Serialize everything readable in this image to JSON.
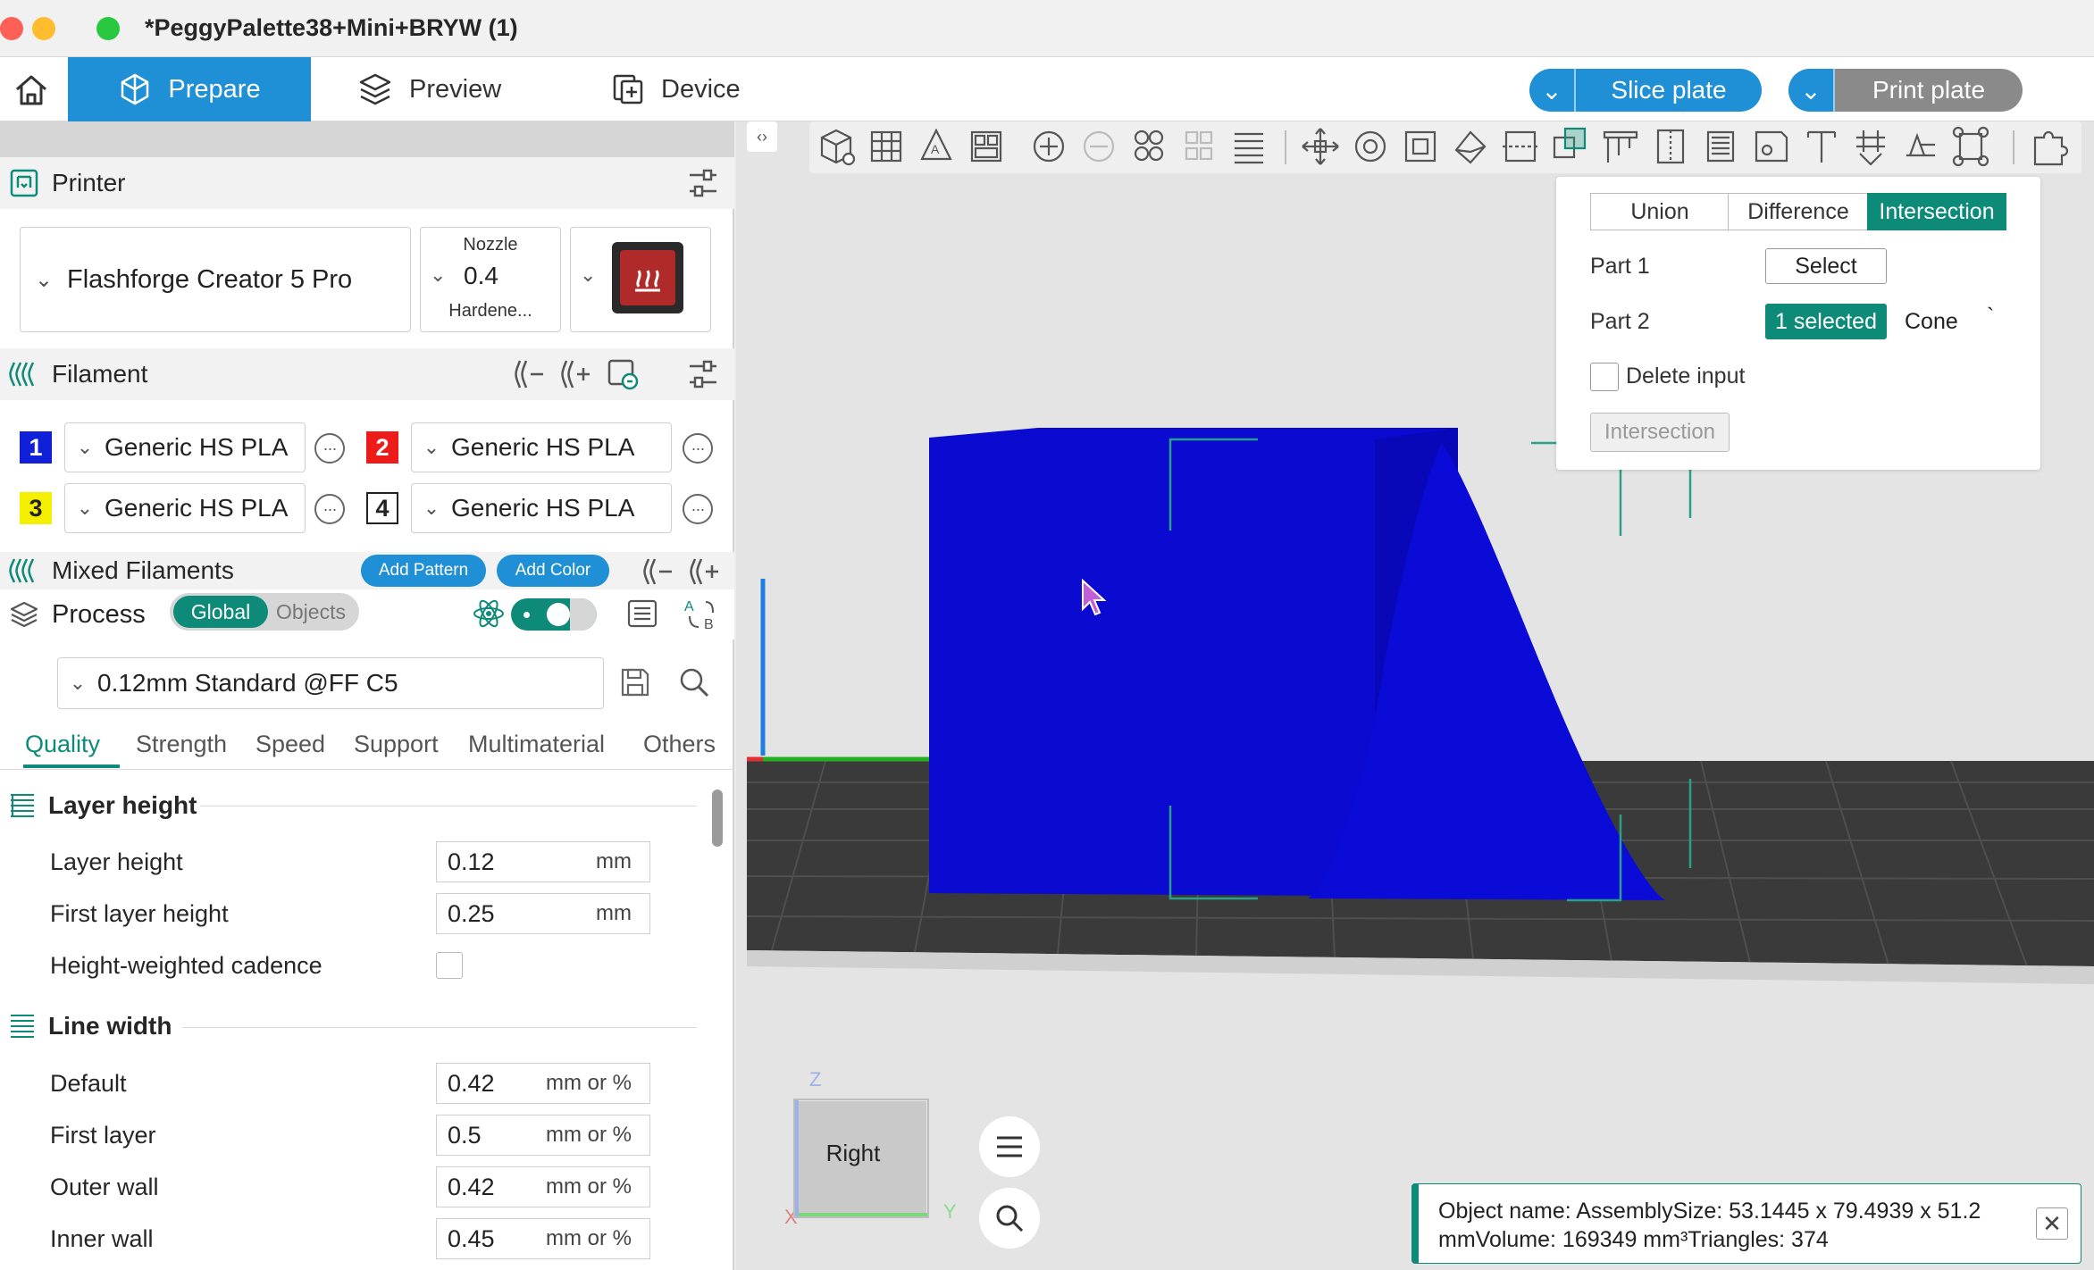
{
  "window": {
    "title": "*PeggyPalette38+Mini+BRYW (1)"
  },
  "nav": {
    "tabs": [
      {
        "label": "Prepare"
      },
      {
        "label": "Preview"
      },
      {
        "label": "Device"
      }
    ],
    "slice_label": "Slice plate",
    "print_label": "Print plate"
  },
  "printer": {
    "section_title": "Printer",
    "name": "Flashforge Creator 5 Pro",
    "nozzle_title": "Nozzle",
    "nozzle_value": "0.4",
    "nozzle_type": "Hardene..."
  },
  "filament": {
    "section_title": "Filament",
    "slots": [
      {
        "num": "1",
        "color": "#1020d8",
        "text_color": "#ffffff",
        "name": "Generic HS PLA"
      },
      {
        "num": "2",
        "color": "#ee1b1b",
        "text_color": "#ffffff",
        "name": "Generic HS PLA"
      },
      {
        "num": "3",
        "color": "#f5f000",
        "text_color": "#222222",
        "name": "Generic HS PLA"
      },
      {
        "num": "4",
        "color": "#ffffff",
        "text_color": "#222222",
        "name": "Generic HS PLA"
      }
    ]
  },
  "mixed": {
    "title": "Mixed Filaments",
    "add_pattern": "Add Pattern",
    "add_color": "Add Color"
  },
  "process": {
    "title": "Process",
    "toggle_global": "Global",
    "toggle_objects": "Objects",
    "preset": "0.12mm Standard @FF C5",
    "tabs": [
      "Quality",
      "Strength",
      "Speed",
      "Support",
      "Multimaterial",
      "Others"
    ],
    "active_tab": "Quality"
  },
  "settings": {
    "layer_height_group": "Layer height",
    "layer_height_label": "Layer height",
    "layer_height_value": "0.12",
    "layer_height_unit": "mm",
    "first_layer_height_label": "First layer height",
    "first_layer_height_value": "0.25",
    "first_layer_height_unit": "mm",
    "height_weighted_label": "Height-weighted cadence",
    "height_weighted_checked": false,
    "line_width_group": "Line width",
    "default_label": "Default",
    "default_value": "0.42",
    "first_layer_label": "First layer",
    "first_layer_value": "0.5",
    "outer_wall_label": "Outer wall",
    "outer_wall_value": "0.42",
    "inner_wall_label": "Inner wall",
    "inner_wall_value": "0.45",
    "unit_mm_or_pct": "mm or %"
  },
  "boolean": {
    "union": "Union",
    "difference": "Difference",
    "intersection": "Intersection",
    "part1_label": "Part 1",
    "part1_button": "Select",
    "part2_label": "Part 2",
    "part2_button": "1 selected",
    "part2_name": "Cone",
    "part2_extra": "`",
    "delete_input_label": "Delete input",
    "action_button": "Intersection"
  },
  "view_cube": {
    "face": "Right",
    "axis_z": "Z",
    "axis_y": "Y",
    "axis_x": "X"
  },
  "info": {
    "line1": "Object name: AssemblySize: 53.1445 x 79.4939 x 51.2",
    "line2": "mmVolume: 169349 mm³Triangles: 374"
  },
  "colors": {
    "accent_blue": "#1f8fd6",
    "accent_teal": "#0d8a78",
    "model_blue": "#0a0ad0"
  }
}
